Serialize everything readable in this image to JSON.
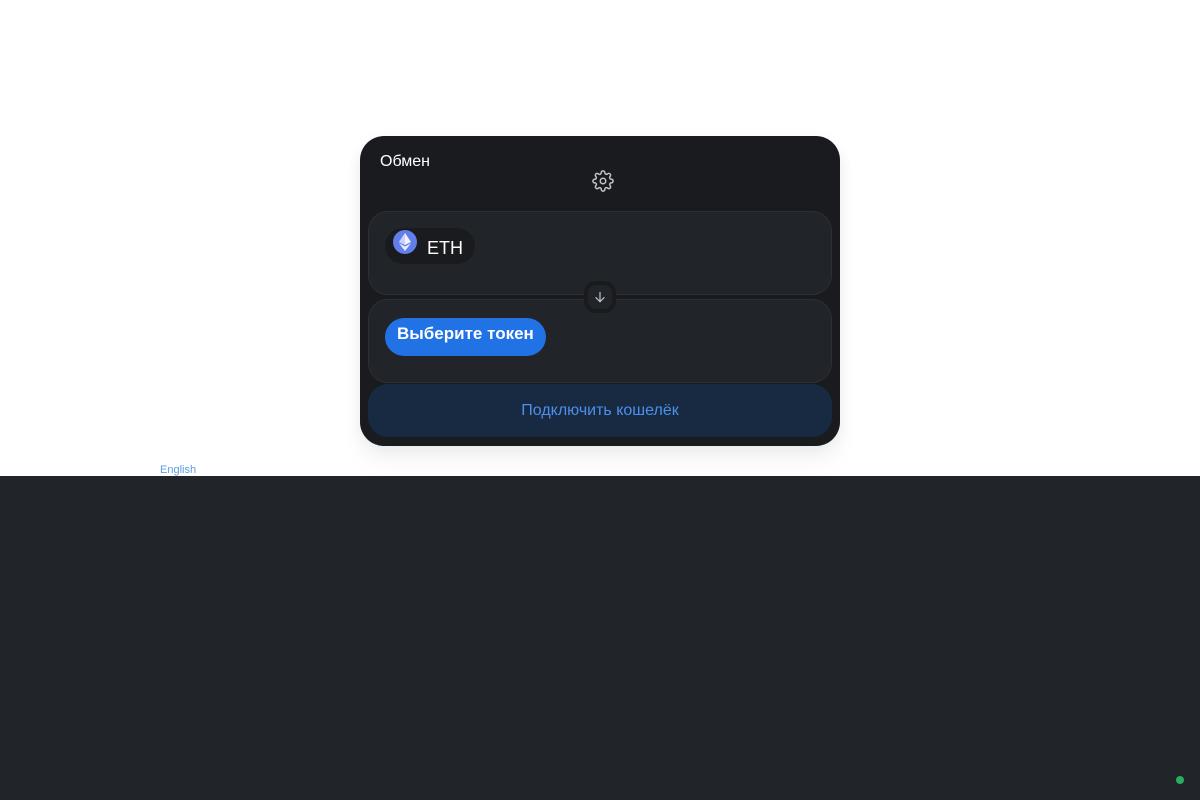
{
  "swap": {
    "title": "Обмен",
    "settings_icon": "gear-icon",
    "input": {
      "token_symbol": "ETH",
      "token_icon": "ethereum-logo-icon"
    },
    "switch_icon": "arrow-down-icon",
    "output": {
      "select_label": "Выберите токен"
    },
    "connect_label": "Подключить кошелёк"
  },
  "footer": {
    "language_link": "English"
  },
  "colors": {
    "card_bg": "#191b1f",
    "panel_bg": "#212429",
    "accent": "#2172e5",
    "connect_bg": "#172a42",
    "connect_text": "#4d8feb",
    "eth_logo": "#627eea",
    "status_dot": "#27ae60"
  }
}
